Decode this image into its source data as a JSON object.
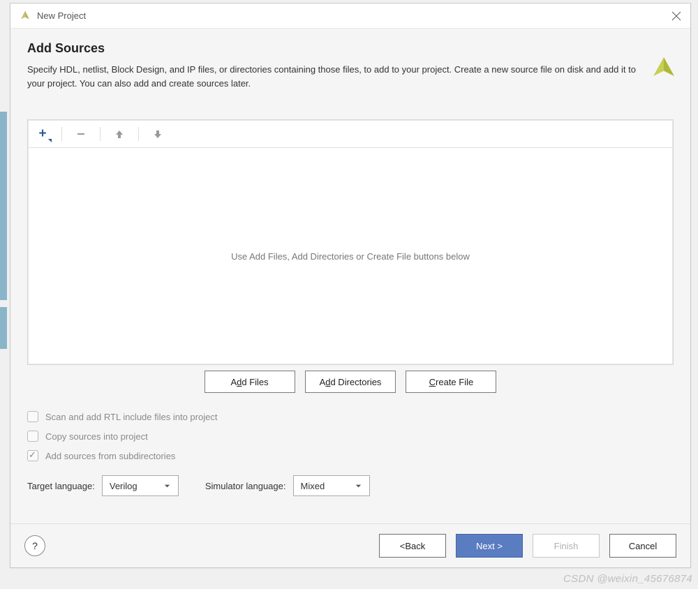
{
  "window": {
    "title": "New Project"
  },
  "header": {
    "title": "Add Sources",
    "description": "Specify HDL, netlist, Block Design, and IP files, or directories containing those files, to add to your project. Create a new source file on disk and add it to your project. You can also add and create sources later."
  },
  "files_panel": {
    "empty_text": "Use Add Files, Add Directories or Create File buttons below",
    "buttons": {
      "add_files_pre": "A",
      "add_files_u": "d",
      "add_files_post": "d Files",
      "add_dirs_pre": "A",
      "add_dirs_u": "d",
      "add_dirs_post": "d Directories",
      "create_pre": "",
      "create_u": "C",
      "create_post": "reate File"
    }
  },
  "options": {
    "scan_pre": "Scan and add RTL ",
    "scan_u": "i",
    "scan_post": "nclude files into project",
    "copy_pre": "Copy ",
    "copy_u": "s",
    "copy_post": "ources into project",
    "sub_pre": "Add so",
    "sub_u": "u",
    "sub_post": "rces from subdirectories",
    "scan_checked": false,
    "copy_checked": false,
    "sub_checked": true
  },
  "language": {
    "target_label": "Target language:",
    "target_value": "Verilog",
    "sim_label": "Simulator language:",
    "sim_value": "Mixed"
  },
  "footer": {
    "back_pre": "< ",
    "back_u": "B",
    "back_post": "ack",
    "next_u": "N",
    "next_post": "ext >",
    "finish_u": "F",
    "finish_post": "inish",
    "cancel": "Cancel",
    "help": "?"
  },
  "watermark": "CSDN @weixin_45676874"
}
